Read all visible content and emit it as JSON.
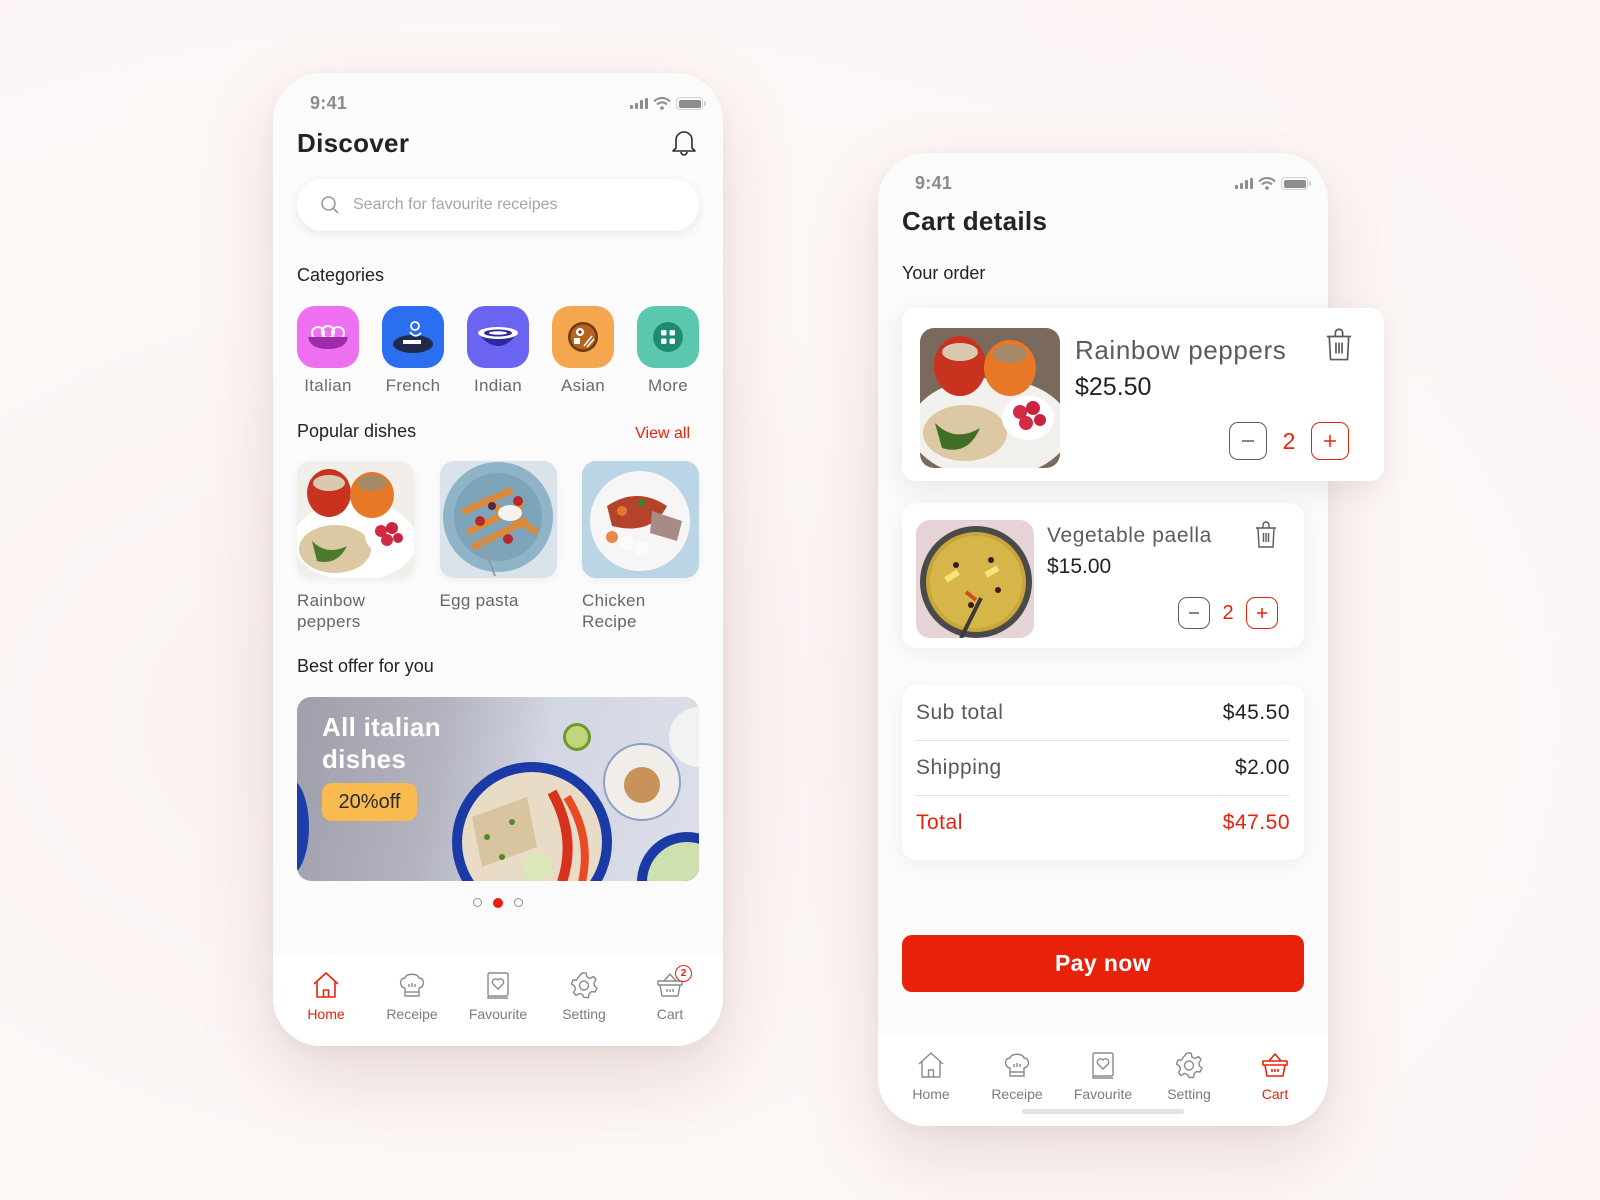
{
  "status_bar": {
    "time": "9:41"
  },
  "discover": {
    "title": "Discover",
    "search_placeholder": "Search for favourite receipes",
    "categories_title": "Categories",
    "categories": [
      {
        "label": "Italian",
        "icon": "pasta-bowl-icon",
        "color": "#ee6ff0"
      },
      {
        "label": "French",
        "icon": "chef-plate-icon",
        "color": "#2b6ff0"
      },
      {
        "label": "Indian",
        "icon": "curry-bowl-icon",
        "color": "#6b63f2"
      },
      {
        "label": "Asian",
        "icon": "sushi-icon",
        "color": "#f4a74e"
      },
      {
        "label": "More",
        "icon": "grid-icon",
        "color": "#5cc7af"
      }
    ],
    "popular_title": "Popular dishes",
    "view_all": "View all",
    "dishes": [
      {
        "name": "Rainbow peppers"
      },
      {
        "name": "Egg pasta"
      },
      {
        "name": "Chicken Recipe"
      }
    ],
    "offer_title": "Best offer for you",
    "banner": {
      "title": "All italian dishes",
      "badge": "20%off"
    },
    "carousel": {
      "count": 3,
      "active_index": 1
    }
  },
  "tabbar": {
    "tabs": [
      {
        "label": "Home",
        "icon": "home-icon"
      },
      {
        "label": "Receipe",
        "icon": "chef-hat-icon"
      },
      {
        "label": "Favourite",
        "icon": "favourite-book-icon"
      },
      {
        "label": "Setting",
        "icon": "gear-icon"
      },
      {
        "label": "Cart",
        "icon": "basket-icon"
      }
    ],
    "cart_badge": "2",
    "discover_active": "Home",
    "cart_active": "Cart"
  },
  "cart": {
    "title": "Cart details",
    "order_title": "Your order",
    "items": [
      {
        "name": "Rainbow peppers",
        "price": "$25.50",
        "qty": "2"
      },
      {
        "name": "Vegetable paella",
        "price": "$15.00",
        "qty": "2"
      }
    ],
    "summary": {
      "subtotal_label": "Sub total",
      "subtotal": "$45.50",
      "shipping_label": "Shipping",
      "shipping": "$2.00",
      "total_label": "Total",
      "total": "$47.50"
    },
    "pay_label": "Pay now"
  },
  "colors": {
    "accent": "#e8220a",
    "badge_yellow": "#f9bb50",
    "text_dark": "#232323"
  }
}
